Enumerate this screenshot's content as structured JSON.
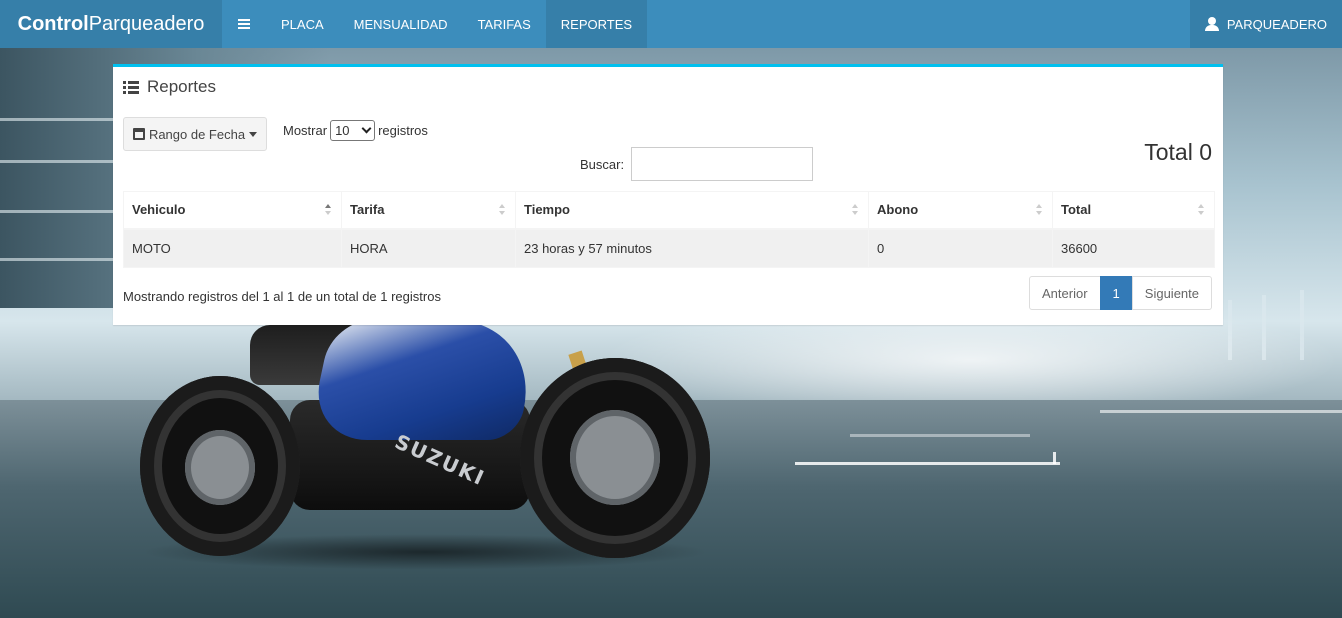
{
  "brand": {
    "bold": "Control",
    "light": "Parqueadero"
  },
  "nav": {
    "toggle_icon": "bars-icon",
    "items": [
      "PLACA",
      "MENSUALIDAD",
      "TARIFAS",
      "REPORTES"
    ],
    "active": "REPORTES",
    "user_icon": "user-icon",
    "user": "PARQUEADERO"
  },
  "box": {
    "title_icon": "list-icon",
    "title": "Reportes",
    "range_button": "Rango de Fecha",
    "length_prefix": "Mostrar",
    "length_value": "10",
    "length_suffix": "registros",
    "search_label": "Buscar:",
    "search_value": "",
    "total": "Total 0"
  },
  "table": {
    "columns": [
      "Vehiculo",
      "Tarifa",
      "Tiempo",
      "Abono",
      "Total"
    ],
    "rows": [
      [
        "MOTO",
        "HORA",
        "23 horas y 57 minutos",
        "0",
        "36600"
      ]
    ]
  },
  "footer": {
    "info": "Mostrando registros del 1 al 1 de un total de 1 registros",
    "prev": "Anterior",
    "page": "1",
    "next": "Siguiente"
  },
  "colors": {
    "navbar": "#3c8dbc",
    "navbar_dark": "#367fa9",
    "box_accent": "#00c0ef",
    "pager_active": "#337ab7"
  }
}
